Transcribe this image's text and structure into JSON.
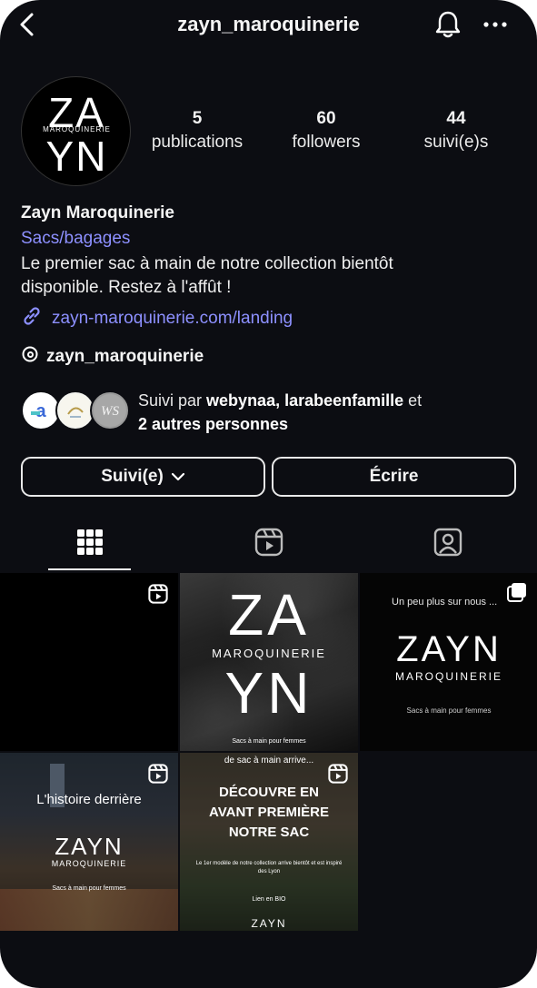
{
  "header": {
    "username": "zayn_maroquinerie"
  },
  "profile": {
    "avatar_logo_line1": "ZA",
    "avatar_logo_mid": "MAROQUINERIE",
    "avatar_logo_line2": "YN",
    "stats": [
      {
        "value": "5",
        "label": "publications"
      },
      {
        "value": "60",
        "label": "followers"
      },
      {
        "value": "44",
        "label": "suivi(e)s"
      }
    ],
    "name": "Zayn Maroquinerie",
    "category": "Sacs/bagages",
    "bio": "Le premier sac à main de notre collection bientôt disponible. Restez à l'affût !",
    "link": "zayn-maroquinerie.com/landing",
    "threads_handle": "zayn_maroquinerie",
    "followed_by_prefix": "Suivi par ",
    "followed_by_names": "webynaa, larabeenfamille",
    "followed_by_mid": " et",
    "followed_by_more": "2 autres personnes"
  },
  "actions": {
    "following_label": "Suivi(e)",
    "message_label": "Écrire"
  },
  "tabs": [
    "grid",
    "reels",
    "tagged"
  ],
  "posts": [
    {
      "type": "reel",
      "big_top": "",
      "small": "",
      "subtitle": ""
    },
    {
      "type": "image",
      "big_top": "ZA",
      "small": "MAROQUINERIE",
      "big_bottom": "YN",
      "subtitle": "Sacs à main pour femmes"
    },
    {
      "type": "carousel",
      "heading": "Un peu plus sur nous ...",
      "big": "ZAYN",
      "small": "MAROQUINERIE",
      "subtitle": "Sacs à main pour femmes"
    },
    {
      "type": "reel",
      "heading": "L'histoire derrière",
      "big": "ZAYN",
      "small": "MAROQUINERIE",
      "subtitle": "Sacs à main pour femmes"
    },
    {
      "type": "reel",
      "heading_top": "de sac à main arrive...",
      "headline1": "DÉCOUVRE EN",
      "headline2": "AVANT PREMIÈRE",
      "headline3": "NOTRE SAC",
      "fine": "Le 1er modèle de notre collection arrive bientôt et est inspiré des Lyon",
      "cta": "Lien en BIO",
      "footer_logo": "ZAYN"
    }
  ],
  "colors": {
    "background": "#0c0d12",
    "link_blue": "#8d90ff",
    "text": "#f4f4f4"
  }
}
